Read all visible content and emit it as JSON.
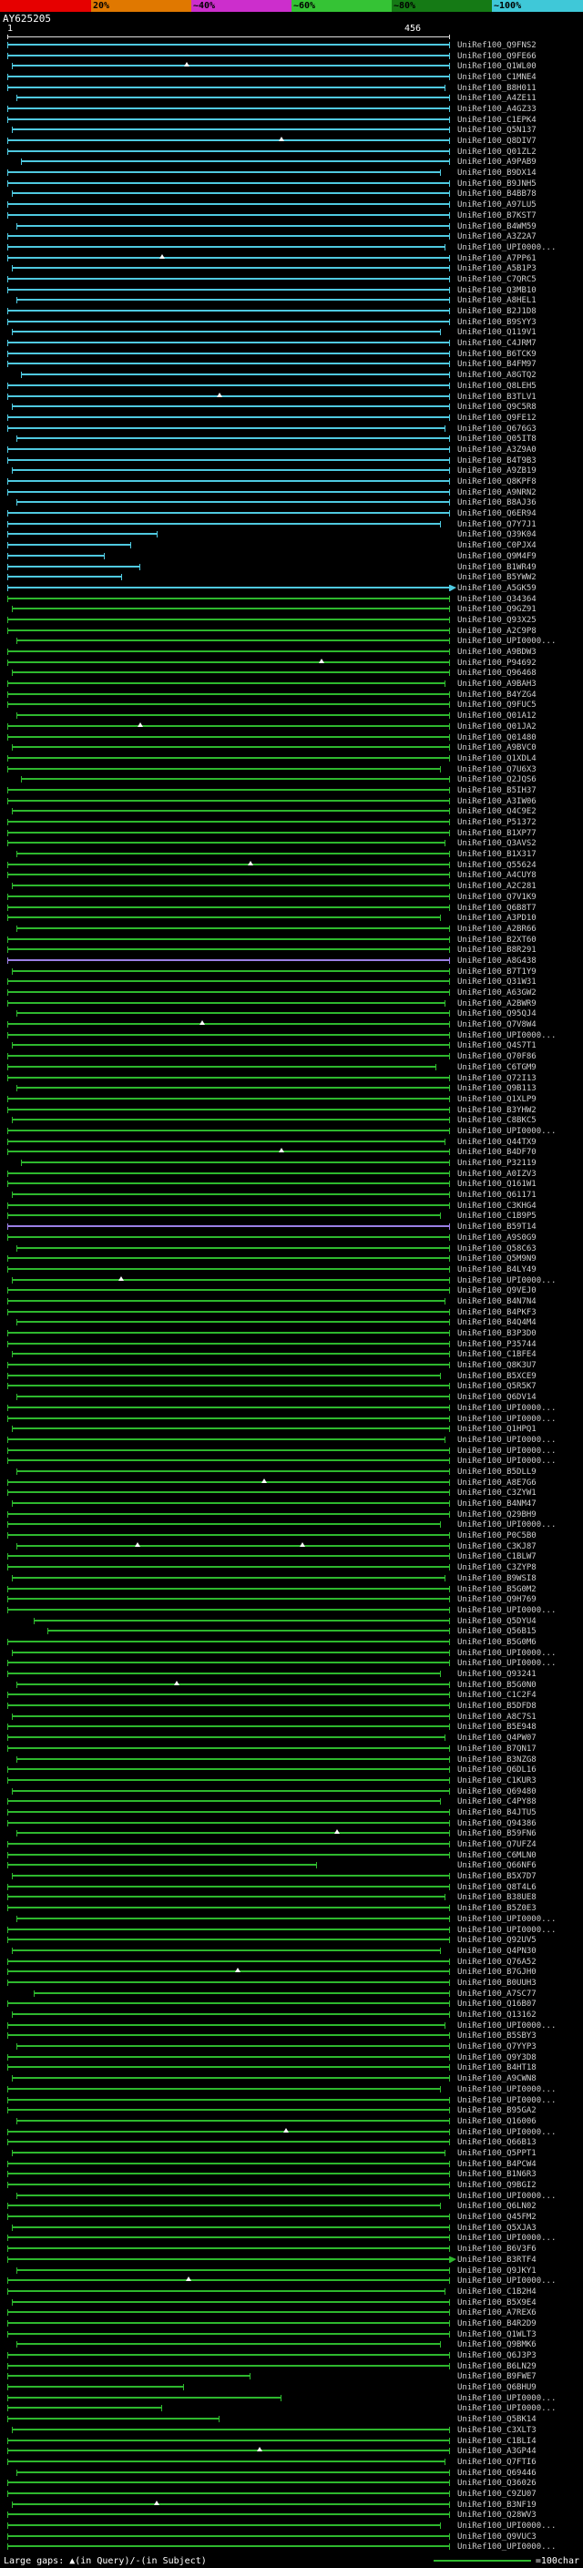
{
  "legend": {
    "large_gaps": "Large gaps: ▲(in Query)/-(in Subject)",
    "scale_label": "=100char"
  },
  "chart_data": {
    "type": "bar",
    "orientation": "horizontal",
    "title": "",
    "query": {
      "id": "AY625205",
      "start": 1,
      "end": 456
    },
    "identity_scale": {
      "segment_colors": [
        "#e60000",
        "#e07800",
        "#cc2ecc",
        "#35c335",
        "#157a15",
        "#3fc8d8"
      ],
      "tick_labels": [
        "20%",
        "~40%",
        "~60%",
        "~80%",
        "~100%"
      ]
    },
    "colors": [
      "#4fc9e0",
      "#2eb82e",
      "#9b7fe6"
    ],
    "label_prefix": "UniRef100_",
    "hits": [
      [
        "Q9FNS2",
        0,
        0,
        100
      ],
      [
        "Q9FE66",
        0,
        0,
        100
      ],
      [
        "Q1WL00",
        0,
        1,
        100,
        0,
        [
          40
        ]
      ],
      [
        "C1MNE4",
        0,
        0,
        100
      ],
      [
        "B8H011",
        0,
        0,
        99
      ],
      [
        "A4ZE11",
        0,
        2,
        100
      ],
      [
        "A4GZ33",
        0,
        0,
        100
      ],
      [
        "C1EPK4",
        0,
        0,
        100
      ],
      [
        "Q5N137",
        0,
        1,
        100
      ],
      [
        "Q8DIV7",
        0,
        0,
        100,
        0,
        [
          62
        ]
      ],
      [
        "Q01ZL2",
        0,
        0,
        100
      ],
      [
        "A9PAB9",
        0,
        3,
        100
      ],
      [
        "B9DX14",
        0,
        0,
        98
      ],
      [
        "B9JNH5",
        0,
        0,
        100
      ],
      [
        "B4BB78",
        0,
        1,
        100
      ],
      [
        "A97LU5",
        0,
        0,
        100
      ],
      [
        "B7KST7",
        0,
        0,
        100
      ],
      [
        "B4WM59",
        0,
        2,
        100
      ],
      [
        "A3Z2A7",
        0,
        0,
        100
      ],
      [
        "UPI0000...",
        0,
        0,
        99
      ],
      [
        "A7PP61",
        0,
        0,
        100,
        0,
        [
          35
        ]
      ],
      [
        "A5B1P3",
        0,
        1,
        100
      ],
      [
        "C7QRC5",
        0,
        0,
        100
      ],
      [
        "Q3MB10",
        0,
        0,
        100
      ],
      [
        "A8HEL1",
        0,
        2,
        100
      ],
      [
        "B2J1D8",
        0,
        0,
        100
      ],
      [
        "B9SYY3",
        0,
        0,
        100
      ],
      [
        "Q119V1",
        0,
        1,
        98
      ],
      [
        "C4JRM7",
        0,
        0,
        100
      ],
      [
        "B6TCK9",
        0,
        0,
        100
      ],
      [
        "B4FM97",
        0,
        0,
        100
      ],
      [
        "A8GTQ2",
        0,
        3,
        100
      ],
      [
        "Q8LEH5",
        0,
        0,
        100
      ],
      [
        "B3TLV1",
        0,
        0,
        100,
        0,
        [
          48
        ]
      ],
      [
        "Q9C5R8",
        0,
        1,
        100
      ],
      [
        "Q9FE12",
        0,
        0,
        100
      ],
      [
        "Q676G3",
        0,
        0,
        99
      ],
      [
        "Q05IT8",
        0,
        2,
        100
      ],
      [
        "A3Z9A0",
        0,
        0,
        100
      ],
      [
        "B4T9B3",
        0,
        0,
        100
      ],
      [
        "A9ZB19",
        0,
        1,
        100
      ],
      [
        "Q8KPF8",
        0,
        0,
        100
      ],
      [
        "A9NRN2",
        0,
        0,
        100
      ],
      [
        "B8AJ36",
        0,
        2,
        100
      ],
      [
        "Q6ER94",
        0,
        0,
        100
      ],
      [
        "Q7Y7J1",
        0,
        0,
        98
      ],
      [
        "Q39K04",
        0,
        0,
        34
      ],
      [
        "C0PJX4",
        0,
        0,
        28
      ],
      [
        "Q9M4F9",
        0,
        0,
        22
      ],
      [
        "B1WR49",
        0,
        0,
        30
      ],
      [
        "B5YWW2",
        0,
        0,
        26
      ],
      [
        "A5GK59",
        0,
        0,
        100,
        1
      ],
      [
        "Q34364",
        1,
        0,
        100
      ],
      [
        "Q9GZ91",
        1,
        1,
        100
      ],
      [
        "Q93X25",
        1,
        0,
        100
      ],
      [
        "A2C9P8",
        1,
        0,
        100
      ],
      [
        "UPI0000...",
        1,
        2,
        100
      ],
      [
        "A9BDW3",
        1,
        0,
        100
      ],
      [
        "P94692",
        1,
        0,
        100,
        0,
        [
          71
        ]
      ],
      [
        "Q96468",
        1,
        1,
        100
      ],
      [
        "A9BAH3",
        1,
        0,
        99
      ],
      [
        "B4YZG4",
        1,
        0,
        100
      ],
      [
        "Q9FUC5",
        1,
        0,
        100
      ],
      [
        "Q01A12",
        1,
        2,
        100
      ],
      [
        "Q01JA2",
        1,
        0,
        100,
        0,
        [
          30
        ]
      ],
      [
        "Q01480",
        1,
        0,
        100
      ],
      [
        "A9BVC0",
        1,
        1,
        100
      ],
      [
        "Q1XDL4",
        1,
        0,
        100
      ],
      [
        "Q7U6X3",
        1,
        0,
        98
      ],
      [
        "Q2JQS6",
        1,
        3,
        100
      ],
      [
        "B5IH37",
        1,
        0,
        100
      ],
      [
        "A3IW06",
        1,
        0,
        100
      ],
      [
        "Q4C9E2",
        1,
        1,
        100
      ],
      [
        "P51372",
        1,
        0,
        100
      ],
      [
        "B1XP77",
        1,
        0,
        100
      ],
      [
        "Q3AVS2",
        1,
        0,
        99
      ],
      [
        "B1X317",
        1,
        2,
        100
      ],
      [
        "Q55624",
        1,
        0,
        100,
        0,
        [
          55
        ]
      ],
      [
        "A4CUY8",
        1,
        0,
        100
      ],
      [
        "A2C281",
        1,
        1,
        100
      ],
      [
        "Q7V1K9",
        1,
        0,
        100
      ],
      [
        "Q6B8T7",
        1,
        0,
        100
      ],
      [
        "A3PD10",
        1,
        0,
        98
      ],
      [
        "A2BR66",
        1,
        2,
        100
      ],
      [
        "B2XT60",
        1,
        0,
        100
      ],
      [
        "B8R291",
        1,
        0,
        100
      ],
      [
        "A8G438",
        2,
        0,
        100
      ],
      [
        "B7T1Y9",
        1,
        1,
        100
      ],
      [
        "Q31W31",
        1,
        0,
        100
      ],
      [
        "A63GW2",
        1,
        0,
        100
      ],
      [
        "A2BWR9",
        1,
        0,
        99
      ],
      [
        "Q95QJ4",
        1,
        2,
        100
      ],
      [
        "Q7V8W4",
        1,
        0,
        100,
        0,
        [
          44
        ]
      ],
      [
        "UPI0000...",
        1,
        0,
        100
      ],
      [
        "Q4S7T1",
        1,
        1,
        100
      ],
      [
        "Q70F86",
        1,
        0,
        100
      ],
      [
        "C6TGM9",
        1,
        0,
        97
      ],
      [
        "Q72I13",
        1,
        0,
        100
      ],
      [
        "Q9B113",
        1,
        2,
        100
      ],
      [
        "Q1XLP9",
        1,
        0,
        100
      ],
      [
        "B3YHW2",
        1,
        0,
        100
      ],
      [
        "C8BKC5",
        1,
        1,
        100
      ],
      [
        "UPI0000...",
        1,
        0,
        100
      ],
      [
        "Q44TX9",
        1,
        0,
        99
      ],
      [
        "B4DF70",
        1,
        0,
        100,
        0,
        [
          62
        ]
      ],
      [
        "P32119",
        1,
        3,
        100
      ],
      [
        "A0IZV3",
        1,
        0,
        100
      ],
      [
        "Q161W1",
        1,
        0,
        100
      ],
      [
        "Q61171",
        1,
        1,
        100
      ],
      [
        "C3KHG4",
        1,
        0,
        100
      ],
      [
        "C1B9P5",
        1,
        0,
        98
      ],
      [
        "B59T14",
        2,
        0,
        100
      ],
      [
        "A9S0G9",
        1,
        0,
        100
      ],
      [
        "Q58C63",
        1,
        2,
        100
      ],
      [
        "Q5M9N9",
        1,
        0,
        100
      ],
      [
        "B4LY49",
        1,
        0,
        100
      ],
      [
        "UPI0000...",
        1,
        1,
        100,
        0,
        [
          25
        ]
      ],
      [
        "Q9VEJ0",
        1,
        0,
        100
      ],
      [
        "B4N7N4",
        1,
        0,
        99
      ],
      [
        "B4PKF3",
        1,
        0,
        100
      ],
      [
        "B4Q4M4",
        1,
        2,
        100
      ],
      [
        "B3P3D0",
        1,
        0,
        100
      ],
      [
        "P35744",
        1,
        0,
        100
      ],
      [
        "C1BFE4",
        1,
        1,
        100
      ],
      [
        "Q8K3U7",
        1,
        0,
        100
      ],
      [
        "B5XCE9",
        1,
        0,
        98
      ],
      [
        "Q5R5K7",
        1,
        0,
        100
      ],
      [
        "Q6DV14",
        1,
        2,
        100
      ],
      [
        "UPI0000...",
        1,
        0,
        100
      ],
      [
        "UPI0000...",
        1,
        0,
        100
      ],
      [
        "Q1HPQ1",
        1,
        1,
        100
      ],
      [
        "UPI0000...",
        1,
        0,
        99
      ],
      [
        "UPI0000...",
        1,
        0,
        100
      ],
      [
        "UPI0000...",
        1,
        0,
        100
      ],
      [
        "B5DLL9",
        1,
        2,
        100
      ],
      [
        "A8E7G6",
        1,
        0,
        100,
        0,
        [
          58
        ]
      ],
      [
        "C3ZYW1",
        1,
        0,
        100
      ],
      [
        "B4NM47",
        1,
        1,
        100
      ],
      [
        "Q29BH9",
        1,
        0,
        100
      ],
      [
        "UPI0000...",
        1,
        0,
        98
      ],
      [
        "P0C5B0",
        1,
        0,
        100
      ],
      [
        "C3KJ87",
        1,
        2,
        100,
        0,
        [
          28,
          66
        ]
      ],
      [
        "C1BLW7",
        1,
        0,
        100
      ],
      [
        "C3ZYP8",
        1,
        0,
        100
      ],
      [
        "B9WSI8",
        1,
        1,
        99
      ],
      [
        "B5G0M2",
        1,
        0,
        100
      ],
      [
        "Q9H769",
        1,
        0,
        100
      ],
      [
        "UPI0000...",
        1,
        0,
        100
      ],
      [
        "Q5DYU4",
        1,
        6,
        100
      ],
      [
        "Q56B15",
        1,
        9,
        100
      ],
      [
        "B5G0M6",
        1,
        0,
        100
      ],
      [
        "UPI0000...",
        1,
        1,
        100
      ],
      [
        "UPI0000...",
        1,
        0,
        100
      ],
      [
        "Q93241",
        1,
        0,
        98
      ],
      [
        "B5G0N0",
        1,
        2,
        100,
        0,
        [
          37
        ]
      ],
      [
        "C1C2F4",
        1,
        0,
        100
      ],
      [
        "B5DFD8",
        1,
        0,
        100
      ],
      [
        "A8C7S1",
        1,
        1,
        100
      ],
      [
        "B5E948",
        1,
        0,
        100
      ],
      [
        "Q4PW07",
        1,
        0,
        99
      ],
      [
        "B7QN17",
        1,
        0,
        100
      ],
      [
        "B3NZG8",
        1,
        2,
        100
      ],
      [
        "Q6DL16",
        1,
        0,
        100
      ],
      [
        "C1KUR3",
        1,
        0,
        100
      ],
      [
        "Q69480",
        1,
        1,
        100
      ],
      [
        "C4PY88",
        1,
        0,
        98
      ],
      [
        "B4JTU5",
        1,
        0,
        100
      ],
      [
        "Q94386",
        1,
        0,
        100
      ],
      [
        "B59FN6",
        1,
        2,
        100,
        0,
        [
          74
        ]
      ],
      [
        "Q7UFZ4",
        1,
        0,
        100
      ],
      [
        "C6MLN0",
        1,
        0,
        100
      ],
      [
        "Q66NF6",
        1,
        0,
        70
      ],
      [
        "B5X7D7",
        1,
        1,
        100
      ],
      [
        "Q8T4L6",
        1,
        0,
        100
      ],
      [
        "B38UE8",
        1,
        0,
        99
      ],
      [
        "B5Z0E3",
        1,
        0,
        100
      ],
      [
        "UPI0000...",
        1,
        2,
        100
      ],
      [
        "UPI0000...",
        1,
        0,
        100
      ],
      [
        "Q92UV5",
        1,
        0,
        100
      ],
      [
        "Q4PN30",
        1,
        1,
        98
      ],
      [
        "Q76A52",
        1,
        0,
        100
      ],
      [
        "B7GJH0",
        1,
        0,
        100,
        0,
        [
          52
        ]
      ],
      [
        "B0UUH3",
        1,
        0,
        100
      ],
      [
        "A7SC77",
        1,
        6,
        100
      ],
      [
        "Q16B07",
        1,
        0,
        100
      ],
      [
        "Q13162",
        1,
        1,
        100
      ],
      [
        "UPI0000...",
        1,
        0,
        99
      ],
      [
        "B5SBY3",
        1,
        0,
        100
      ],
      [
        "Q7YYP3",
        1,
        2,
        100
      ],
      [
        "Q9Y3D8",
        1,
        0,
        100
      ],
      [
        "B4HT18",
        1,
        0,
        100
      ],
      [
        "A9CWN8",
        1,
        1,
        100
      ],
      [
        "UPI0000...",
        1,
        0,
        98
      ],
      [
        "UPI0000...",
        1,
        0,
        100
      ],
      [
        "B95GA2",
        1,
        0,
        100
      ],
      [
        "Q16006",
        1,
        2,
        100
      ],
      [
        "UPI0000...",
        1,
        0,
        100,
        0,
        [
          63
        ]
      ],
      [
        "Q66B13",
        1,
        0,
        100
      ],
      [
        "Q5PPT1",
        1,
        1,
        99
      ],
      [
        "B4PCW4",
        1,
        0,
        100
      ],
      [
        "B1N6R3",
        1,
        0,
        100
      ],
      [
        "Q9BGI2",
        1,
        0,
        100
      ],
      [
        "UPI0000...",
        1,
        2,
        100
      ],
      [
        "Q6LN02",
        1,
        0,
        98
      ],
      [
        "Q45FM2",
        1,
        0,
        100
      ],
      [
        "Q5XJA3",
        1,
        1,
        100
      ],
      [
        "UPI0000...",
        1,
        0,
        100
      ],
      [
        "B6V3F6",
        1,
        0,
        100
      ],
      [
        "B3RTF4",
        1,
        0,
        100,
        1
      ],
      [
        "Q9JKY1",
        1,
        2,
        100
      ],
      [
        "UPI0000...",
        1,
        0,
        100,
        0,
        [
          41
        ]
      ],
      [
        "C1B2H4",
        1,
        0,
        99
      ],
      [
        "B5X9E4",
        1,
        1,
        100
      ],
      [
        "A7REX6",
        1,
        0,
        100
      ],
      [
        "B4R2D9",
        1,
        0,
        100
      ],
      [
        "Q1WLT3",
        1,
        0,
        100
      ],
      [
        "Q9BMK6",
        1,
        2,
        98
      ],
      [
        "Q6J3P3",
        1,
        0,
        100
      ],
      [
        "B6LN29",
        1,
        0,
        100
      ],
      [
        "B9FWE7",
        1,
        0,
        55
      ],
      [
        "Q6BHU9",
        1,
        0,
        40
      ],
      [
        "UPI0000...",
        1,
        0,
        62
      ],
      [
        "UPI0000...",
        1,
        0,
        35
      ],
      [
        "Q5BK14",
        1,
        0,
        48
      ],
      [
        "C3XLT3",
        1,
        1,
        100
      ],
      [
        "C1BLI4",
        1,
        0,
        100
      ],
      [
        "A3GP44",
        1,
        0,
        100,
        0,
        [
          57
        ]
      ],
      [
        "Q7FTI6",
        1,
        0,
        99
      ],
      [
        "Q69446",
        1,
        2,
        100
      ],
      [
        "Q36026",
        1,
        0,
        100
      ],
      [
        "C9ZU07",
        1,
        0,
        100
      ],
      [
        "B3NF19",
        1,
        1,
        100,
        0,
        [
          33
        ]
      ],
      [
        "Q28WV3",
        1,
        0,
        100
      ],
      [
        "UPI0000...",
        1,
        0,
        98
      ],
      [
        "Q9VUC3",
        1,
        0,
        100
      ],
      [
        "UPI0000...",
        1,
        0,
        100
      ]
    ]
  }
}
